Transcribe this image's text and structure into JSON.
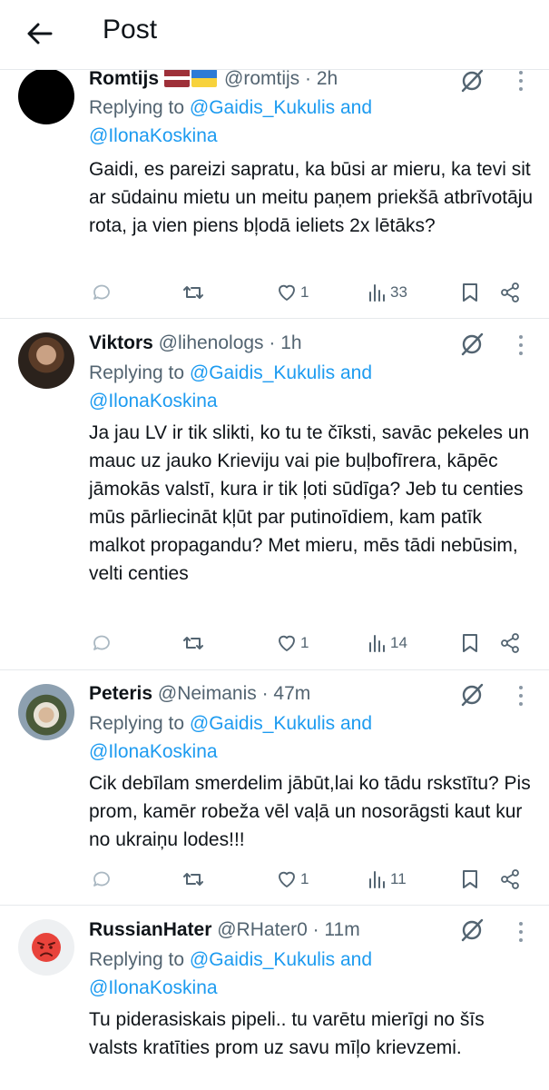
{
  "header": {
    "title": "Post"
  },
  "posts": [
    {
      "name": "Romtijs",
      "handle": "@romtijs",
      "time": "2h",
      "replying_prefix": "Replying to ",
      "mention1": "@Gaidis_Kukulis",
      "and_text": " and",
      "mention2": "@IlonaKoskina",
      "text": "Gaidi, es pareizi sapratu, ka būsi ar mieru, ka tevi sit ar sūdainu mietu un meitu paņem priekšā atbrīvotāju rota, ja vien piens bļodā ieliets 2x lētāks?",
      "likes": "1",
      "views": "33"
    },
    {
      "name": "Viktors",
      "handle": "@lihenologs",
      "time": "1h",
      "replying_prefix": "Replying to ",
      "mention1": "@Gaidis_Kukulis",
      "and_text": " and",
      "mention2": "@IlonaKoskina",
      "text": "Ja jau LV ir tik slikti, ko tu te čīksti, savāc pekeles un mauc uz jauko Krieviju vai pie buļbofīrera, kāpēc jāmokās valstī, kura ir tik ļoti sūdīga? Jeb tu centies mūs pārliecināt kļūt par putinoīdiem, kam patīk malkot propagandu? Met mieru, mēs tādi nebūsim, velti centies",
      "likes": "1",
      "views": "14"
    },
    {
      "name": "Peteris",
      "handle": "@Neimanis",
      "time": "47m",
      "replying_prefix": "Replying to ",
      "mention1": "@Gaidis_Kukulis",
      "and_text": " and",
      "mention2": "@IlonaKoskina",
      "text": "Cik debīlam smerdelim jābūt,lai ko tādu rskstītu? Pis prom, kamēr robeža vēl vaļā un nosorāgsti kaut kur no ukraiņu lodes!!!",
      "likes": "1",
      "views": "11"
    },
    {
      "name": "RussianHater",
      "handle": "@RHater0",
      "time": "11m",
      "replying_prefix": "Replying to ",
      "mention1": "@Gaidis_Kukulis",
      "and_text": " and",
      "mention2": "@IlonaKoskina",
      "text": "Tu piderasiskais pipeli.. tu varētu mierīgi no šīs valsts kratīties prom uz savu mīļo krievzemi."
    }
  ],
  "separator": " · ",
  "icons": [
    "back-arrow-icon",
    "grok-icon",
    "more-icon",
    "reply-icon",
    "retweet-icon",
    "like-icon",
    "views-icon",
    "bookmark-icon",
    "share-icon"
  ],
  "colors": {
    "mention": "#1d9bf0",
    "meta": "#536471",
    "text": "#0f1419"
  }
}
